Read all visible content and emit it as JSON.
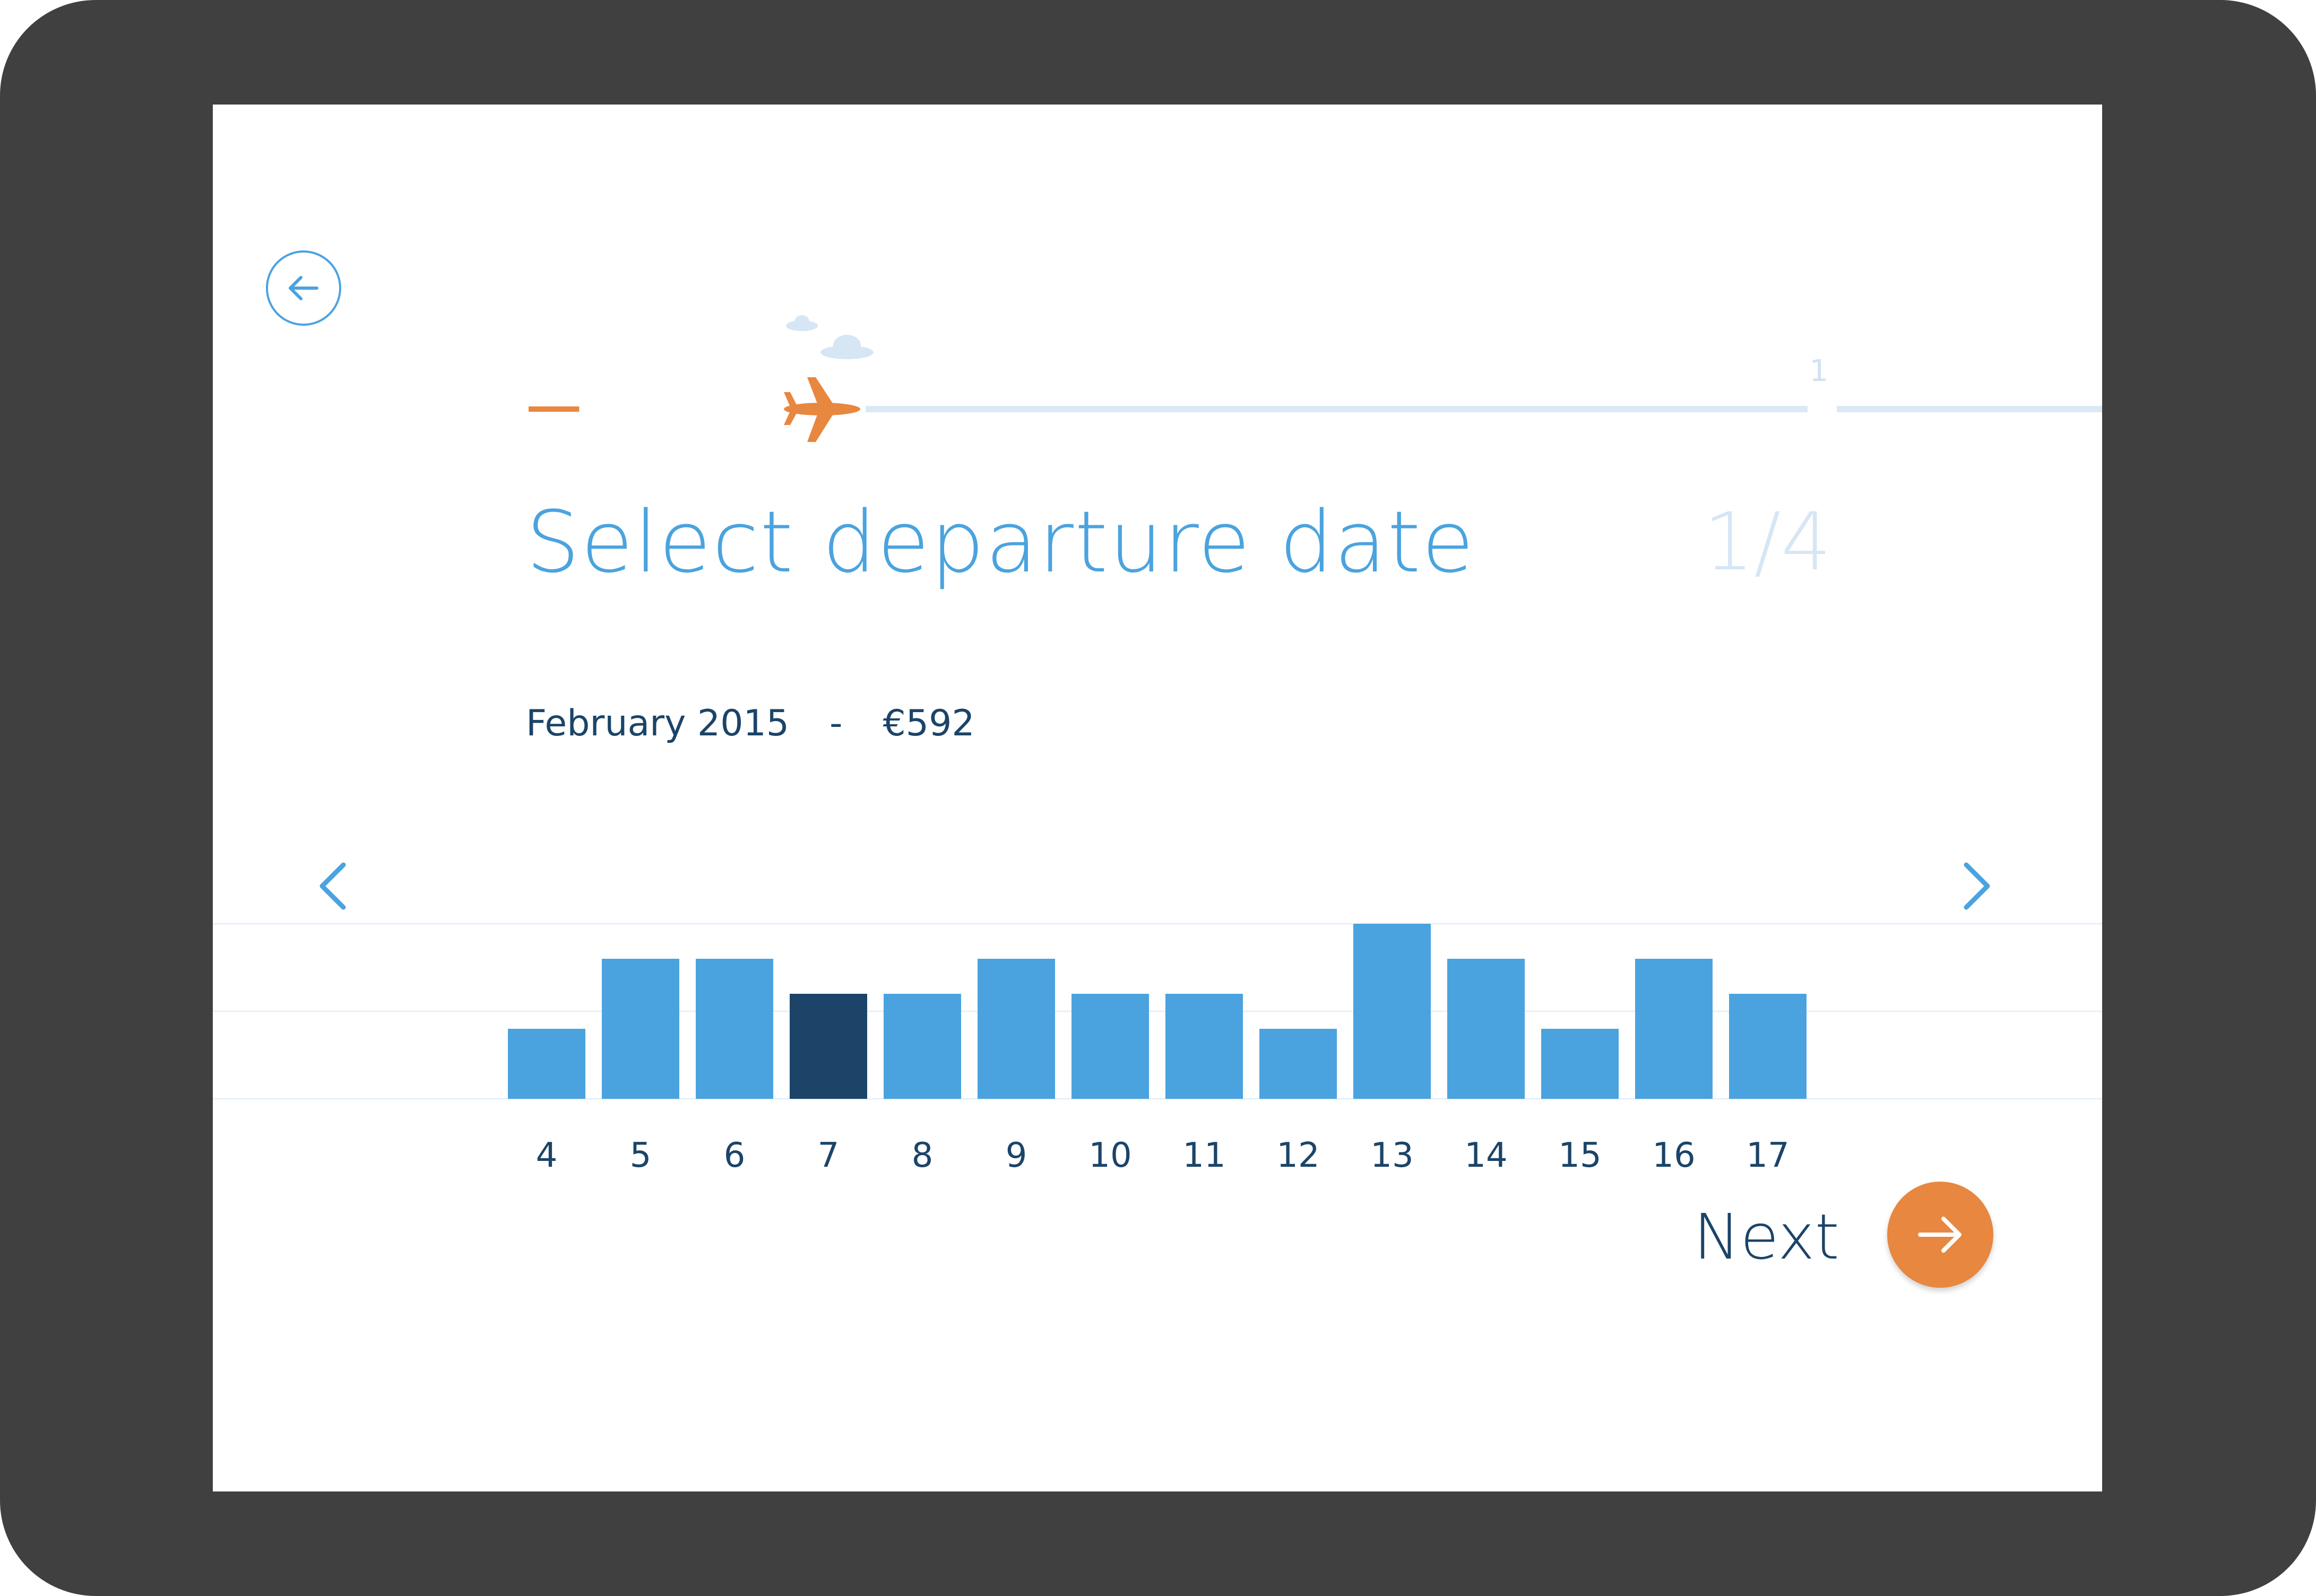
{
  "header": {
    "title": "Select departure date",
    "step_counter": "1/4",
    "step_marker": "1",
    "subtitle": {
      "month": "February 2015",
      "separator": "-",
      "price": "€592"
    }
  },
  "progress": {
    "completed_fraction": 0.26
  },
  "footer": {
    "next_label": "Next"
  },
  "colors": {
    "accent_blue": "#4aa3df",
    "selected_bar": "#1b4468",
    "progress_orange": "#e8873f",
    "track": "#dbe9f7",
    "text_dark": "#1b4468"
  },
  "icons": {
    "back": "arrow-left-icon",
    "prev": "chevron-left-icon",
    "next_page": "chevron-right-icon",
    "next": "arrow-right-icon",
    "plane": "airplane-icon",
    "cloud": "cloud-icon"
  },
  "chart_data": {
    "type": "bar",
    "categories": [
      "4",
      "5",
      "6",
      "7",
      "8",
      "9",
      "10",
      "11",
      "12",
      "13",
      "14",
      "15",
      "16",
      "17"
    ],
    "values": [
      2,
      4,
      4,
      3,
      3,
      4,
      3,
      3,
      2,
      5,
      4,
      2,
      4,
      3
    ],
    "selected": "7",
    "ylim": [
      0,
      5
    ],
    "grid": true
  }
}
